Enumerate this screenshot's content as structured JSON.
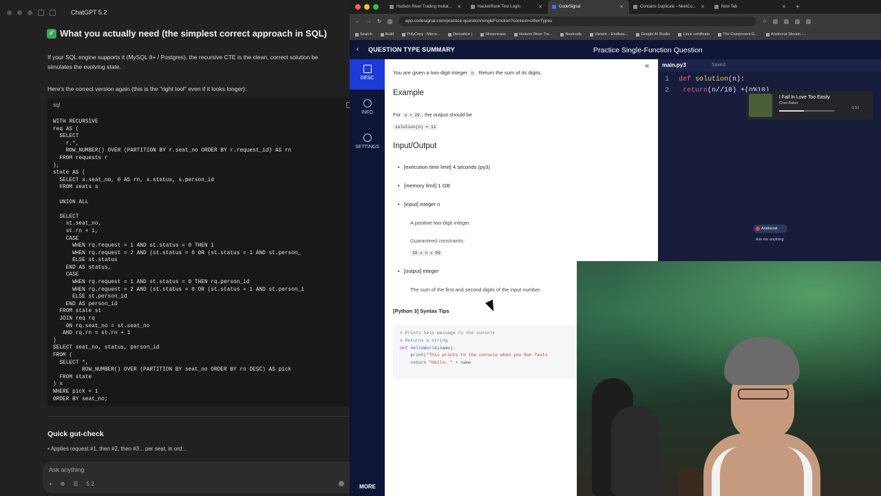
{
  "chat": {
    "app_title": "ChatGPT 5.2",
    "heading": "What you actually need (the simplest correct approach in SQL)",
    "intro_line1": "If your SQL engine supports it (MySQL 8+ / Postgres), the recursive CTE is the clean, correct solution be",
    "intro_line2": "simulates the evolving state.",
    "subintro": "Here's the correct version again (this is the \"right tool\" even if it looks longer):",
    "code_lang": "sql",
    "code": "WITH RECURSIVE\nreq AS (\n  SELECT\n    r.*,\n    ROW_NUMBER() OVER (PARTITION BY r.seat_no ORDER BY r.request_id) AS rn\n  FROM requests r\n),\nstate AS (\n  SELECT s.seat_no, 0 AS rn, s.status, s.person_id\n  FROM seats s\n\n  UNION ALL\n\n  SELECT\n    st.seat_no,\n    st.rn + 1,\n    CASE\n      WHEN rq.request = 1 AND st.status = 0 THEN 1\n      WHEN rq.request = 2 AND (st.status = 0 OR (st.status = 1 AND st.person_\n      ELSE st.status\n    END AS status,\n    CASE\n      WHEN rq.request = 1 AND st.status = 0 THEN rq.person_id\n      WHEN rq.request = 2 AND (st.status = 0 OR (st.status = 1 AND st.person_i\n      ELSE st.person_id\n    END AS person_id\n  FROM state st\n  JOIN req rq\n    ON rq.seat_no = st.seat_no\n   AND rq.rn = st.rn + 1\n)\nSELECT seat_no, status, person_id\nFROM (\n  SELECT *,\n         ROW_NUMBER() OVER (PARTITION BY seat_no ORDER BY rn DESC) AS pick\n  FROM state\n) x\nWHERE pick = 1\nORDER BY seat_no;",
    "gut_check_title": "Quick gut-check",
    "gut_check_line": "• Applies request #1, then #2, then #3... per seat, in ord...",
    "composer_placeholder": "Ask anything",
    "composer_model": "5.2"
  },
  "browser": {
    "tabs": [
      {
        "label": "Hudson River Trading Invitat...",
        "active": false
      },
      {
        "label": "HackerRank Test Login",
        "active": false
      },
      {
        "label": "CodeSignal",
        "active": true
      },
      {
        "label": "Contains Duplicate - NeetCo...",
        "active": false
      },
      {
        "label": "New Tab",
        "active": false
      }
    ],
    "url": "app.codesignal.com/practice-question/singleFunction?context=otherTypes",
    "bookmarks": [
      "Search",
      "Build",
      "PolyCopy - Mirror...",
      "Derivative |",
      "Streamease",
      "Hudson River Tra...",
      "Neetcode",
      "Variant – Endless...",
      "Google AI Studio",
      "Linux certificate",
      "The Component G...",
      "Aristocrat Stream -..."
    ]
  },
  "codesignal": {
    "back_label": "QUESTION TYPE SUMMARY",
    "title": "Practice Single-Function Question",
    "side": [
      {
        "label": "DESC",
        "icon": "document-icon"
      },
      {
        "label": "INFO",
        "icon": "info-icon"
      },
      {
        "label": "SETTINGS",
        "icon": "gear-icon"
      }
    ],
    "more_label": "MORE",
    "intro_pre": "You are given a two-digit integer",
    "intro_var": "n",
    "intro_post": ". Return the sum of its digits.",
    "example_head": "Example",
    "example_for": "For",
    "example_chip": "n = 29",
    "example_tail": ", the output should be",
    "example_result": "solution(n) = 11",
    "io_head": "Input/Output",
    "b_time": "[execution time limit] 4 seconds (py3)",
    "b_mem": "[memory limit] 1 GB",
    "b_input": "[input] integer n",
    "input_desc": "A positive two-digit integer.",
    "guaranteed": "Guaranteed constraints:",
    "constraint": "10 ≤ n ≤ 99",
    "b_output": "[output] integer",
    "output_desc": "The sum of the first and second digits of the input number.",
    "tips_head": "[Python 3] Syntax Tips",
    "tips_code": {
      "l1": "# Prints help message to the console",
      "l2": "# Returns a string",
      "l3_kw": "def",
      "l3_fn": "helloWorld",
      "l3_rest": "(name):",
      "l4_pre": "    print(",
      "l4_str": "\"This prints to the console when you Run Tests",
      "l5_pre": "    return ",
      "l5_str": "\"Hello, \"",
      "l5_post": " + name"
    }
  },
  "editor": {
    "filename": "main.py3",
    "saved": "Saved",
    "line1_no": "1",
    "line1_kw": "def",
    "line1_fn": "solution",
    "line1_rest": "(n):",
    "line2_no": "2",
    "line2_kw": "return",
    "line2_rest": "(n//10) +(n%10)"
  },
  "overlays": {
    "now_playing_song": "I Fall In Love Too Easily",
    "now_playing_artist": "Chet Baker",
    "now_playing_time": "-1:52",
    "assistant_pill": "Aristocrat",
    "assistant_ask": "Ask me anything"
  },
  "colors": {
    "codesignal_navy": "#0e1536",
    "codesignal_blue": "#1d3bd6",
    "editor_bg": "#161c3a",
    "chat_bg": "#212121"
  }
}
